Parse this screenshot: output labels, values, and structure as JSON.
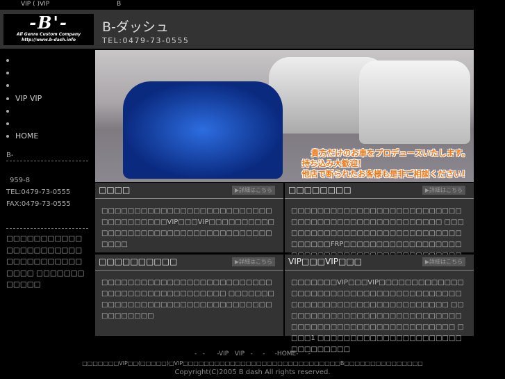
{
  "topbar": {
    "left": "VIP ( )VIP",
    "center": "B"
  },
  "header": {
    "logo_mark": "-B'-",
    "logo_sub1": "All Genre Custom Company",
    "logo_sub2": "http://www.b-dash.info",
    "title": "B-ダッシュ",
    "tel": "TEL:0479-73-0555"
  },
  "nav": [
    "",
    "",
    "",
    "VIP VIP",
    "",
    "",
    "HOME"
  ],
  "sidebar": {
    "company": "B-",
    "address": "959-8",
    "tel": "TEL:0479-73-0555",
    "fax": "FAX:0479-73-0555",
    "note": "□□□□□□□□□□□□□□□□□□□□□□□□□□□□□□□□□□□□□ □□□□□□□□□□□□"
  },
  "banner": {
    "line1": "貴方だけのお車をプロデュースいたします。",
    "line2": "持ち込み大歓迎！",
    "line3": "他店で断られたお客様も是非ご相談ください！"
  },
  "panels": [
    {
      "title": "□□□□",
      "more": "▶詳細はこちら",
      "body": "□□□□□□□□□□□□□□□□□□□□□□□□□□□□□□□□□□□□VIP□□□VIP□□□□□□□□□□□□□□□□□□□□□□□□□□□□□□□□□□□□□□□□"
    },
    {
      "title": "□□□□□□□□",
      "more": "▶詳細はこちら",
      "body": "□□□□□□□□□□□□□□□□□□□□□□□□□□□□□□□□□□□□□□□□□□□□□□□□□ □□□□□□□□□□□□□□□□□□□□□□□□□□□□□□□□□□□FRP□□□□□□□□□□□□□□□□□□□□□□□□□□□□□□□□□□□□□□□□□□□□□□"
    },
    {
      "title": "□□□□□□□□□□",
      "more": "▶詳細はこちら",
      "body": "□□□□□□□□□□□□□□□□□□□□□□□□□□□□□□□□□□□□□□□□□□□□□ □□□□□□□□□□□□□□□□□□□□□□□□□□□□□□□□□□□□□□□□□"
    },
    {
      "title": "VIP□□□VIP□□□",
      "more": "▶詳細はこちら",
      "body": "□□□□□□□VIP□□□VIP□□□□□□□□□□□□□□□□□□□□□□□□□□□□□□□□□□□□□□□□□□□□□□□□□□□□□□□□□□□□□□□ □□□□□□□□□□□□□□□□□□□□□□□□□□□□□□□□□□□□□□□□□□□□□□□□□□□□□ □□□□1 □□□□□□□□□□□□□□□□□□□□□□□□□□□□□□□"
    }
  ],
  "footer": {
    "links": "-   -      -VIP   VIP   -     -     -HOME-     -",
    "desc": "□□□□□□□VIP□□(□□□□□)□VIP□□□□□□□□□□□□□□□□□□□□□□□□□□□□□□B□□□□□□□□□□□□□□□",
    "copyright": "Copyright(C)2005 B dash All rights reserved."
  }
}
